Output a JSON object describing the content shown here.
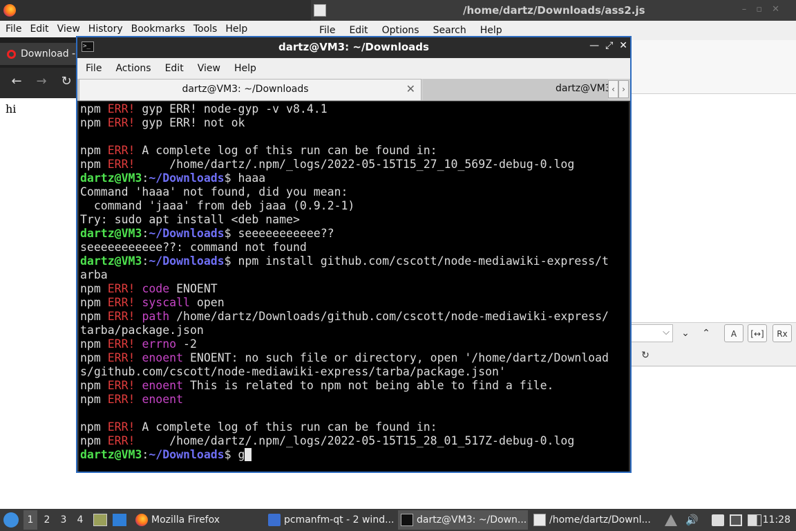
{
  "firefox": {
    "menu": [
      "File",
      "Edit",
      "View",
      "History",
      "Bookmarks",
      "Tools",
      "Help"
    ],
    "tab_title": "Download -",
    "page_text": "hi"
  },
  "editor": {
    "title": "/home/dartz/Downloads/ass2.js",
    "menu": [
      "File",
      "Edit",
      "Options",
      "Search",
      "Help"
    ]
  },
  "terminal": {
    "title": "dartz@VM3: ~/Downloads",
    "menu": [
      "File",
      "Actions",
      "Edit",
      "View",
      "Help"
    ],
    "tabs": [
      "dartz@VM3: ~/Downloads",
      "dartz@VM3:"
    ],
    "user_host": "dartz@VM3",
    "path": "~/Downloads",
    "lines": [
      [
        [
          "npm ",
          ""
        ],
        [
          "ERR!",
          "e"
        ],
        [
          " gyp ERR! node-gyp -v v8.4.1",
          ""
        ]
      ],
      [
        [
          "npm ",
          ""
        ],
        [
          "ERR!",
          "e"
        ],
        [
          " gyp ERR! not ok",
          ""
        ]
      ],
      [],
      [
        [
          "npm ",
          ""
        ],
        [
          "ERR!",
          "e"
        ],
        [
          " A complete log of this run can be found in:",
          ""
        ]
      ],
      [
        [
          "npm ",
          ""
        ],
        [
          "ERR!",
          "e"
        ],
        [
          "     /home/dartz/.npm/_logs/2022-05-15T15_27_10_569Z-debug-0.log",
          ""
        ]
      ],
      [
        [
          "dartz@VM3",
          "u"
        ],
        [
          ":",
          ""
        ],
        [
          "~/Downloads",
          "p"
        ],
        [
          "$ haaa",
          ""
        ]
      ],
      [
        [
          "Command 'haaa' not found, did you mean:",
          ""
        ]
      ],
      [
        [
          "  command 'jaaa' from deb jaaa (0.9.2-1)",
          ""
        ]
      ],
      [
        [
          "Try: sudo apt install <deb name>",
          ""
        ]
      ],
      [
        [
          "dartz@VM3",
          "u"
        ],
        [
          ":",
          ""
        ],
        [
          "~/Downloads",
          "p"
        ],
        [
          "$ seeeeeeeeeee??",
          ""
        ]
      ],
      [
        [
          "seeeeeeeeeee??: command not found",
          ""
        ]
      ],
      [
        [
          "dartz@VM3",
          "u"
        ],
        [
          ":",
          ""
        ],
        [
          "~/Downloads",
          "p"
        ],
        [
          "$ npm install github.com/cscott/node-mediawiki-express/t",
          ""
        ]
      ],
      [
        [
          "arba",
          ""
        ]
      ],
      [
        [
          "npm ",
          ""
        ],
        [
          "ERR!",
          "e"
        ],
        [
          " ",
          ""
        ],
        [
          "code",
          "k"
        ],
        [
          " ENOENT",
          ""
        ]
      ],
      [
        [
          "npm ",
          ""
        ],
        [
          "ERR!",
          "e"
        ],
        [
          " ",
          ""
        ],
        [
          "syscall",
          "k"
        ],
        [
          " open",
          ""
        ]
      ],
      [
        [
          "npm ",
          ""
        ],
        [
          "ERR!",
          "e"
        ],
        [
          " ",
          ""
        ],
        [
          "path",
          "k"
        ],
        [
          " /home/dartz/Downloads/github.com/cscott/node-mediawiki-express/",
          ""
        ]
      ],
      [
        [
          "tarba/package.json",
          ""
        ]
      ],
      [
        [
          "npm ",
          ""
        ],
        [
          "ERR!",
          "e"
        ],
        [
          " ",
          ""
        ],
        [
          "errno",
          "k"
        ],
        [
          " -2",
          ""
        ]
      ],
      [
        [
          "npm ",
          ""
        ],
        [
          "ERR!",
          "e"
        ],
        [
          " ",
          ""
        ],
        [
          "enoent",
          "k"
        ],
        [
          " ENOENT: no such file or directory, open '/home/dartz/Download",
          ""
        ]
      ],
      [
        [
          "s/github.com/cscott/node-mediawiki-express/tarba/package.json'",
          ""
        ]
      ],
      [
        [
          "npm ",
          ""
        ],
        [
          "ERR!",
          "e"
        ],
        [
          " ",
          ""
        ],
        [
          "enoent",
          "k"
        ],
        [
          " This is related to npm not being able to find a file.",
          ""
        ]
      ],
      [
        [
          "npm ",
          ""
        ],
        [
          "ERR!",
          "e"
        ],
        [
          " ",
          ""
        ],
        [
          "enoent",
          "k"
        ]
      ],
      [],
      [
        [
          "npm ",
          ""
        ],
        [
          "ERR!",
          "e"
        ],
        [
          " A complete log of this run can be found in:",
          ""
        ]
      ],
      [
        [
          "npm ",
          ""
        ],
        [
          "ERR!",
          "e"
        ],
        [
          "     /home/dartz/.npm/_logs/2022-05-15T15_28_01_517Z-debug-0.log",
          ""
        ]
      ]
    ],
    "current_command": "g"
  },
  "taskbar": {
    "workspaces": [
      "1",
      "2",
      "3",
      "4"
    ],
    "tasks": [
      "Mozilla Firefox",
      "pcmanfm-qt - 2 wind...",
      "dartz@VM3: ~/Down...",
      "/home/dartz/Downl..."
    ],
    "clock": "11:28"
  },
  "icons": {
    "firefox": "firefox-logo-icon",
    "editor": "text-editor-icon",
    "terminal": "terminal-icon",
    "start": "start-menu-icon",
    "folder": "folder-icon",
    "volume": "volume-icon",
    "network": "network-icon",
    "clipboard": "clipboard-icon",
    "screen": "display-icon",
    "battery": "battery-icon"
  }
}
